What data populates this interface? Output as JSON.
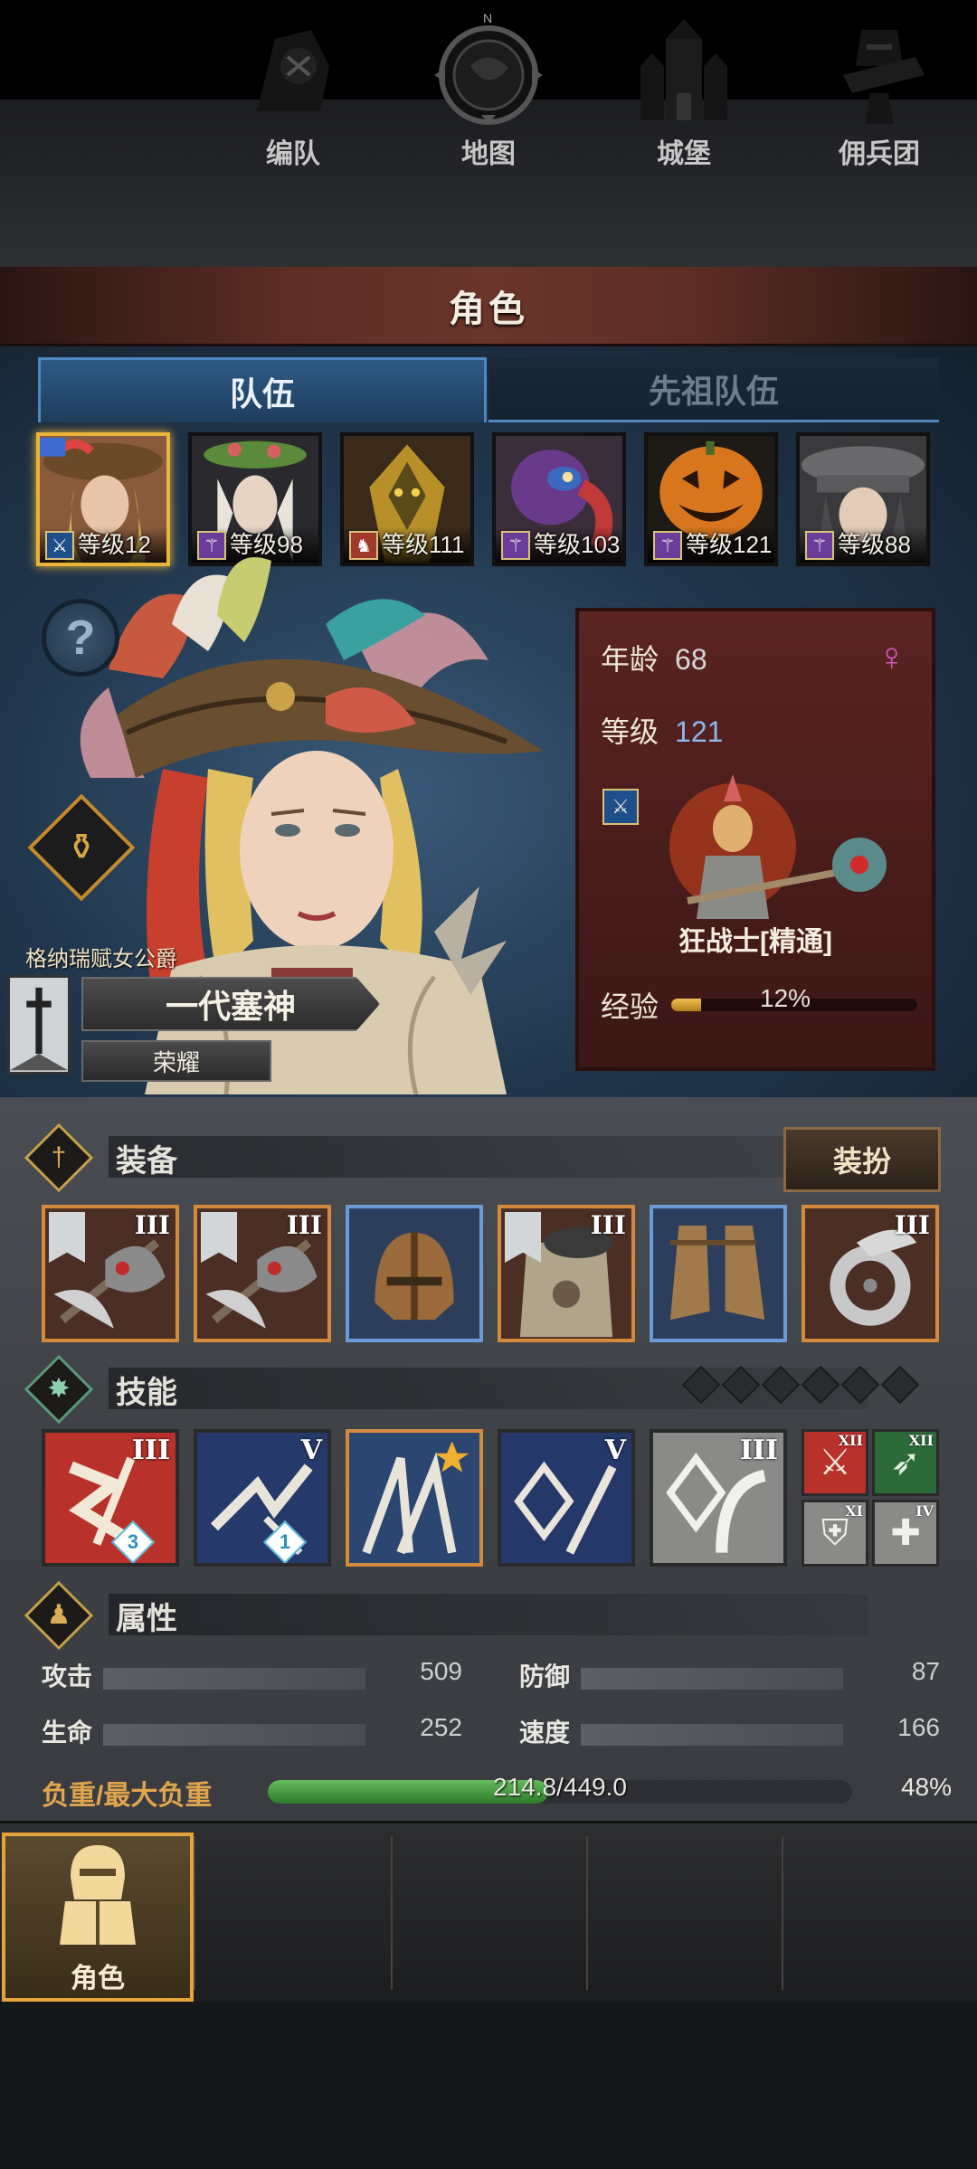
{
  "header": {
    "title": "角色"
  },
  "tabs": [
    {
      "label": "队伍",
      "active": true
    },
    {
      "label": "先祖队伍",
      "active": false
    }
  ],
  "team": [
    {
      "level_label": "等级12",
      "level": 12,
      "class_icon": "sword-icon",
      "selected": true
    },
    {
      "level_label": "等级98",
      "level": 98,
      "class_icon": "staff-icon",
      "selected": false
    },
    {
      "level_label": "等级111",
      "level": 111,
      "class_icon": "horse-icon",
      "selected": false
    },
    {
      "level_label": "等级103",
      "level": 103,
      "class_icon": "staff-icon",
      "selected": false
    },
    {
      "level_label": "等级121",
      "level": 121,
      "class_icon": "staff-icon",
      "selected": false
    },
    {
      "level_label": "等级88",
      "level": 88,
      "class_icon": "staff-icon",
      "selected": false
    }
  ],
  "character": {
    "subtitle": "格纳瑞赋女公爵",
    "title": "一代塞神",
    "rank": "荣耀",
    "age_label": "年龄",
    "age": "68",
    "level_label": "等级",
    "level": "121",
    "gender_icon": "female-icon",
    "class_name": "狂战士[精通]",
    "exp_label": "经验",
    "exp_percent_text": "12%",
    "exp_fraction": 0.12
  },
  "equipment": {
    "label": "装备",
    "dress_button": "装扮",
    "slots": [
      {
        "rank": "III",
        "tier": "orange",
        "item": "axe",
        "flag": true
      },
      {
        "rank": "III",
        "tier": "orange",
        "item": "axe",
        "flag": true
      },
      {
        "rank": "",
        "tier": "blue",
        "item": "helmet",
        "flag": false
      },
      {
        "rank": "III",
        "tier": "orange",
        "item": "armor",
        "flag": true
      },
      {
        "rank": "",
        "tier": "blue",
        "item": "boots",
        "flag": false
      },
      {
        "rank": "III",
        "tier": "orange",
        "item": "ring",
        "flag": false
      }
    ]
  },
  "skills": {
    "label": "技能",
    "dots": 6,
    "items": [
      {
        "rank": "III",
        "badge": "3",
        "color": "#b8312a"
      },
      {
        "rank": "V",
        "badge": "1",
        "color": "#253a6a"
      },
      {
        "rank": "",
        "badge": "",
        "color": "#2b4670",
        "star": true
      },
      {
        "rank": "V",
        "badge": "",
        "color": "#24386a"
      },
      {
        "rank": "III",
        "badge": "",
        "color": "#8a8a88"
      }
    ],
    "mini": [
      {
        "rank": "XII",
        "glyph": "sword-icon",
        "color": "#b8312a"
      },
      {
        "rank": "XII",
        "glyph": "wing-icon",
        "color": "#2d6a3a"
      },
      {
        "rank": "XI",
        "glyph": "shield-icon",
        "color": "#8a8a88"
      },
      {
        "rank": "IV",
        "glyph": "cross-icon",
        "color": "#8a8a88"
      }
    ]
  },
  "attributes": {
    "label": "属性",
    "items": [
      {
        "name": "攻击",
        "value": "509"
      },
      {
        "name": "防御",
        "value": "87"
      },
      {
        "name": "生命",
        "value": "252"
      },
      {
        "name": "速度",
        "value": "166"
      }
    ],
    "load_label": "负重/最大负重",
    "load_text": "214.8/449.0",
    "load_percent": "48%",
    "load_fraction": 0.48
  },
  "nav": [
    {
      "label": "角色",
      "icon": "knight-icon",
      "active": true
    },
    {
      "label": "编队",
      "icon": "formation-icon",
      "active": false
    },
    {
      "label": "地图",
      "icon": "compass-icon",
      "active": false
    },
    {
      "label": "城堡",
      "icon": "castle-icon",
      "active": false
    },
    {
      "label": "佣兵团",
      "icon": "mercenary-icon",
      "active": false
    }
  ],
  "compass_letter": "N",
  "colors": {
    "accent_gold": "#e3a53a",
    "tab_blue": "#4f88bf",
    "header_red": "#6a352b",
    "load_green": "#65bb5e"
  }
}
